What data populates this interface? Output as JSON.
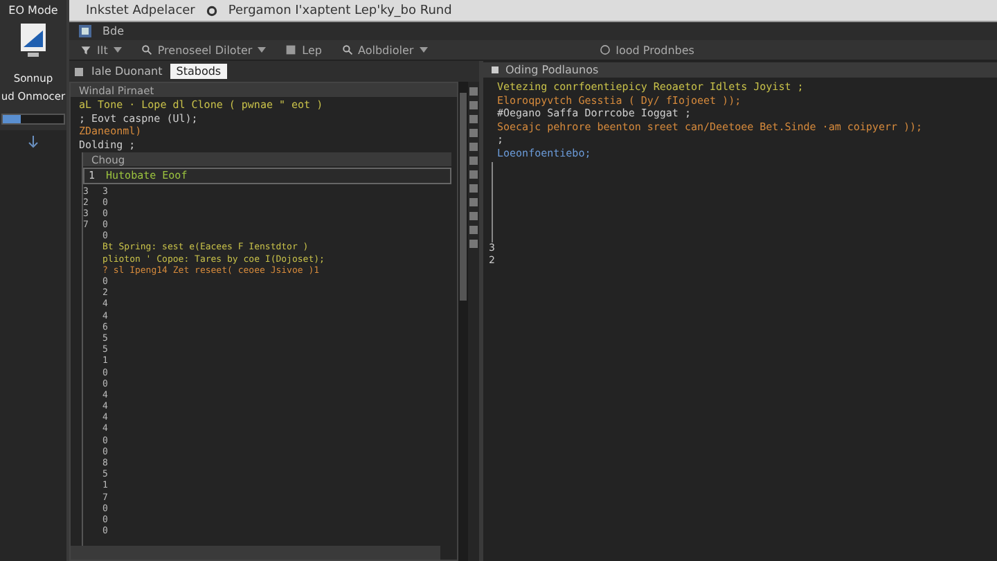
{
  "sidebar": {
    "title": "EO Mode",
    "labels": [
      "Sonnup",
      "ud Onmocer"
    ],
    "slider": {
      "level": 0.3
    }
  },
  "window": {
    "title": "Inkstet Adpelacer",
    "subtitle": "Pergamon I'xaptent Lep'ky_bo Rund"
  },
  "menu": [
    "Bde"
  ],
  "toolbar": [
    {
      "kind": "dropdown",
      "label": "IIt"
    },
    {
      "kind": "dropdown",
      "label": "Prenoseel Diloter"
    },
    {
      "kind": "button",
      "label": "Lep"
    },
    {
      "kind": "dropdown",
      "label": "Aolbdioler"
    },
    {
      "kind": "button",
      "label": "Iood Prodnbes"
    }
  ],
  "left_pane": {
    "tabs": [
      {
        "label": "Iale Duonant",
        "selected": false
      },
      {
        "label": "Stabods",
        "selected": true
      }
    ],
    "panel_title": "Windal Pirnaet",
    "code": [
      {
        "kind": "keyword",
        "text": "aL Tone · Lope dl Clone ( pwnae \" eot )"
      },
      {
        "kind": "plain",
        "text": "; Eovt caspne (Ul);"
      },
      {
        "kind": "string",
        "text": "ZDaneonml)"
      },
      {
        "kind": "plain",
        "text": "Dolding ;"
      }
    ],
    "inner_panel": {
      "title": "Choug",
      "gutter": "1",
      "line": "Hutobate Eoof"
    },
    "rows": [
      {
        "gutter": "3",
        "number": "3"
      },
      {
        "gutter": "2",
        "number": "0"
      },
      {
        "gutter": "3",
        "number": "0"
      },
      {
        "gutter": "7",
        "number": "0"
      },
      {
        "number": "0"
      },
      {
        "kind": "keyword",
        "text": "Bt Spring: sest e(Eacees F Ienstdtor )"
      },
      {
        "kind": "keyword",
        "text": "plioton ' Copoe: Tares by coe I(Dojoset);"
      },
      {
        "kind": "string",
        "text": "? sl Ipeng14 Zet reseet( ceoee Jsivoe )1"
      },
      {
        "number": "0"
      },
      {
        "number": "2"
      },
      {
        "number": "4"
      },
      {
        "number": "4"
      },
      {
        "number": "6"
      },
      {
        "number": "5"
      },
      {
        "number": "5"
      },
      {
        "number": "1"
      },
      {
        "number": "0"
      },
      {
        "number": "0"
      },
      {
        "number": "4"
      },
      {
        "number": "4"
      },
      {
        "number": "4"
      },
      {
        "number": "4"
      },
      {
        "number": "0"
      },
      {
        "number": "0"
      },
      {
        "number": "8"
      },
      {
        "number": "5"
      },
      {
        "number": "1"
      },
      {
        "number": "7"
      },
      {
        "number": "0"
      },
      {
        "number": "0"
      },
      {
        "number": "0"
      }
    ]
  },
  "right_pane": {
    "panel_title": "Oding Podlaunos",
    "code": [
      {
        "kind": "keyword",
        "text": "Vetezing conrfoentiepicy Reoaetor Idlets Joyist ;"
      },
      {
        "kind": "string",
        "text": "Eloroqpyvtch Gesstia ( Dy/ fIojoeet ));"
      },
      {
        "kind": "plain",
        "text": "#Oegano Saffa Dorrcobe Ioggat ;"
      },
      {
        "kind": "string",
        "text": "Soecajc pehrore beenton sreet can/Deetoee Bet.Sinde ·am coipyerr ));"
      },
      {
        "kind": "plain",
        "text": ";"
      },
      {
        "kind": "type",
        "text": "Loeonfoentiebo;"
      }
    ],
    "gutter_numbers": [
      "3",
      "2"
    ]
  }
}
